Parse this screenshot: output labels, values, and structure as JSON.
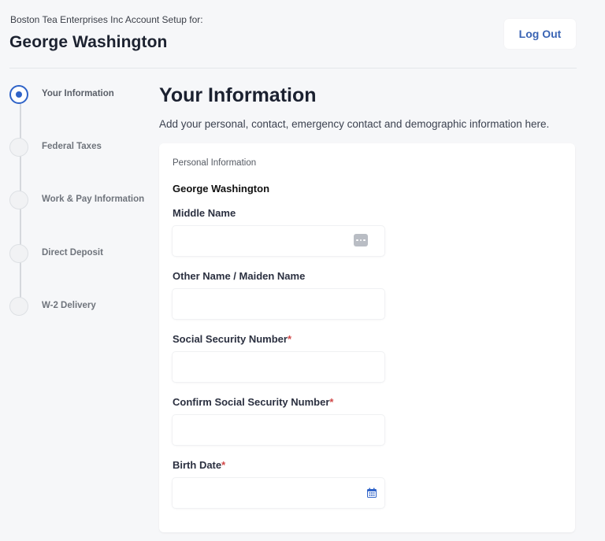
{
  "header": {
    "company_line": "Boston Tea Enterprises Inc Account Setup for:",
    "employee_name": "George Washington",
    "logout_label": "Log Out"
  },
  "stepper": {
    "steps": [
      {
        "label": "Your Information",
        "active": true
      },
      {
        "label": "Federal Taxes",
        "active": false
      },
      {
        "label": "Work & Pay Information",
        "active": false
      },
      {
        "label": "Direct Deposit",
        "active": false
      },
      {
        "label": "W-2 Delivery",
        "active": false
      }
    ]
  },
  "main": {
    "title": "Your Information",
    "description": "Add your personal, contact, emergency contact and demographic information here.",
    "section_label": "Personal Information",
    "person_name": "George Washington",
    "fields": [
      {
        "label": "Middle Name",
        "required": false,
        "value": "",
        "icon": "more-icon"
      },
      {
        "label": "Other Name / Maiden Name",
        "required": false,
        "value": ""
      },
      {
        "label": "Social Security Number",
        "required": true,
        "value": ""
      },
      {
        "label": "Confirm Social Security Number",
        "required": true,
        "value": ""
      },
      {
        "label": "Birth Date",
        "required": true,
        "value": "",
        "icon": "calendar-icon"
      }
    ],
    "required_marker": "*"
  },
  "colors": {
    "accent": "#2f63c8",
    "required": "#d04848",
    "background": "#f6f7f9"
  }
}
